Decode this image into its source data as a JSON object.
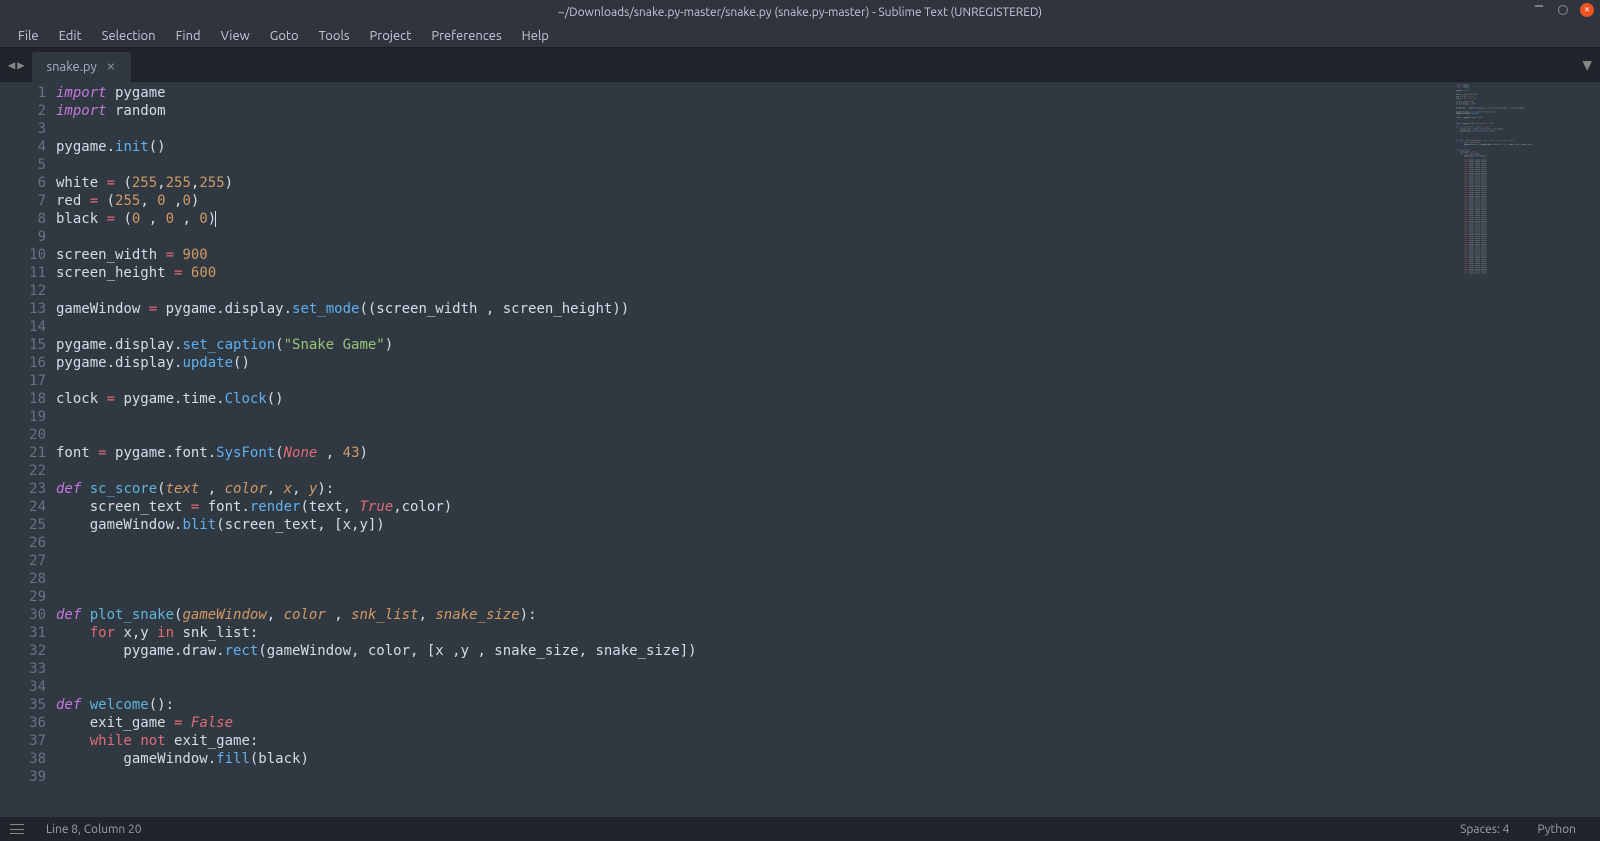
{
  "window": {
    "title": "~/Downloads/snake.py-master/snake.py (snake.py-master) - Sublime Text (UNREGISTERED)"
  },
  "menu": {
    "items": [
      "File",
      "Edit",
      "Selection",
      "Find",
      "View",
      "Goto",
      "Tools",
      "Project",
      "Preferences",
      "Help"
    ]
  },
  "tab": {
    "name": "snake.py"
  },
  "status": {
    "position": "Line 8, Column 20",
    "spaces": "Spaces: 4",
    "syntax": "Python"
  },
  "code": {
    "lines": [
      {
        "n": 1,
        "tokens": [
          {
            "t": "import",
            "c": "kw"
          },
          {
            "t": " pygame",
            "c": "plain"
          }
        ]
      },
      {
        "n": 2,
        "tokens": [
          {
            "t": "import",
            "c": "kw"
          },
          {
            "t": " random",
            "c": "plain"
          }
        ]
      },
      {
        "n": 3,
        "tokens": []
      },
      {
        "n": 4,
        "tokens": [
          {
            "t": "pygame",
            "c": "plain"
          },
          {
            "t": ".",
            "c": "plain"
          },
          {
            "t": "init",
            "c": "call"
          },
          {
            "t": "()",
            "c": "plain"
          }
        ]
      },
      {
        "n": 5,
        "tokens": []
      },
      {
        "n": 6,
        "tokens": [
          {
            "t": "white ",
            "c": "plain"
          },
          {
            "t": "=",
            "c": "op"
          },
          {
            "t": " (",
            "c": "plain"
          },
          {
            "t": "255",
            "c": "num"
          },
          {
            "t": ",",
            "c": "plain"
          },
          {
            "t": "255",
            "c": "num"
          },
          {
            "t": ",",
            "c": "plain"
          },
          {
            "t": "255",
            "c": "num"
          },
          {
            "t": ")",
            "c": "plain"
          }
        ]
      },
      {
        "n": 7,
        "tokens": [
          {
            "t": "red ",
            "c": "plain"
          },
          {
            "t": "=",
            "c": "op"
          },
          {
            "t": " (",
            "c": "plain"
          },
          {
            "t": "255",
            "c": "num"
          },
          {
            "t": ", ",
            "c": "plain"
          },
          {
            "t": "0",
            "c": "num"
          },
          {
            "t": " ,",
            "c": "plain"
          },
          {
            "t": "0",
            "c": "num"
          },
          {
            "t": ")",
            "c": "plain"
          }
        ]
      },
      {
        "n": 8,
        "tokens": [
          {
            "t": "black ",
            "c": "plain"
          },
          {
            "t": "=",
            "c": "op"
          },
          {
            "t": " (",
            "c": "plain"
          },
          {
            "t": "0",
            "c": "num"
          },
          {
            "t": " , ",
            "c": "plain"
          },
          {
            "t": "0",
            "c": "num"
          },
          {
            "t": " , ",
            "c": "plain"
          },
          {
            "t": "0",
            "c": "num"
          },
          {
            "t": ")",
            "c": "plain"
          }
        ],
        "cursor": true
      },
      {
        "n": 9,
        "tokens": []
      },
      {
        "n": 10,
        "tokens": [
          {
            "t": "screen_width ",
            "c": "plain"
          },
          {
            "t": "=",
            "c": "op"
          },
          {
            "t": " ",
            "c": "plain"
          },
          {
            "t": "900",
            "c": "num"
          }
        ]
      },
      {
        "n": 11,
        "tokens": [
          {
            "t": "screen_height ",
            "c": "plain"
          },
          {
            "t": "=",
            "c": "op"
          },
          {
            "t": " ",
            "c": "plain"
          },
          {
            "t": "600",
            "c": "num"
          }
        ]
      },
      {
        "n": 12,
        "tokens": []
      },
      {
        "n": 13,
        "tokens": [
          {
            "t": "gameWindow ",
            "c": "plain"
          },
          {
            "t": "=",
            "c": "op"
          },
          {
            "t": " pygame.display.",
            "c": "plain"
          },
          {
            "t": "set_mode",
            "c": "call"
          },
          {
            "t": "((screen_width , screen_height))",
            "c": "plain"
          }
        ]
      },
      {
        "n": 14,
        "tokens": []
      },
      {
        "n": 15,
        "tokens": [
          {
            "t": "pygame.display.",
            "c": "plain"
          },
          {
            "t": "set_caption",
            "c": "call"
          },
          {
            "t": "(",
            "c": "plain"
          },
          {
            "t": "\"Snake Game\"",
            "c": "str"
          },
          {
            "t": ")",
            "c": "plain"
          }
        ]
      },
      {
        "n": 16,
        "tokens": [
          {
            "t": "pygame.display.",
            "c": "plain"
          },
          {
            "t": "update",
            "c": "call"
          },
          {
            "t": "()",
            "c": "plain"
          }
        ]
      },
      {
        "n": 17,
        "tokens": []
      },
      {
        "n": 18,
        "tokens": [
          {
            "t": "clock ",
            "c": "plain"
          },
          {
            "t": "=",
            "c": "op"
          },
          {
            "t": " pygame.time.",
            "c": "plain"
          },
          {
            "t": "Clock",
            "c": "call"
          },
          {
            "t": "()",
            "c": "plain"
          }
        ]
      },
      {
        "n": 19,
        "tokens": []
      },
      {
        "n": 20,
        "tokens": []
      },
      {
        "n": 21,
        "tokens": [
          {
            "t": "font ",
            "c": "plain"
          },
          {
            "t": "=",
            "c": "op"
          },
          {
            "t": " pygame.font.",
            "c": "plain"
          },
          {
            "t": "SysFont",
            "c": "call"
          },
          {
            "t": "(",
            "c": "plain"
          },
          {
            "t": "None",
            "c": "bool"
          },
          {
            "t": " , ",
            "c": "plain"
          },
          {
            "t": "43",
            "c": "num"
          },
          {
            "t": ")",
            "c": "plain"
          }
        ]
      },
      {
        "n": 22,
        "tokens": []
      },
      {
        "n": 23,
        "tokens": [
          {
            "t": "def",
            "c": "def"
          },
          {
            "t": " ",
            "c": "plain"
          },
          {
            "t": "sc_score",
            "c": "fn"
          },
          {
            "t": "(",
            "c": "plain"
          },
          {
            "t": "text",
            "c": "param"
          },
          {
            "t": " , ",
            "c": "plain"
          },
          {
            "t": "color",
            "c": "param"
          },
          {
            "t": ", ",
            "c": "plain"
          },
          {
            "t": "x",
            "c": "param"
          },
          {
            "t": ", ",
            "c": "plain"
          },
          {
            "t": "y",
            "c": "param"
          },
          {
            "t": "):",
            "c": "plain"
          }
        ]
      },
      {
        "n": 24,
        "tokens": [
          {
            "t": "    screen_text ",
            "c": "plain"
          },
          {
            "t": "=",
            "c": "op"
          },
          {
            "t": " font.",
            "c": "plain"
          },
          {
            "t": "render",
            "c": "call"
          },
          {
            "t": "(text, ",
            "c": "plain"
          },
          {
            "t": "True",
            "c": "bool"
          },
          {
            "t": ",color)",
            "c": "plain"
          }
        ]
      },
      {
        "n": 25,
        "tokens": [
          {
            "t": "    gameWindow.",
            "c": "plain"
          },
          {
            "t": "blit",
            "c": "call"
          },
          {
            "t": "(screen_text, [x,y])",
            "c": "plain"
          }
        ]
      },
      {
        "n": 26,
        "tokens": []
      },
      {
        "n": 27,
        "tokens": []
      },
      {
        "n": 28,
        "tokens": []
      },
      {
        "n": 29,
        "tokens": []
      },
      {
        "n": 30,
        "tokens": [
          {
            "t": "def",
            "c": "def"
          },
          {
            "t": " ",
            "c": "plain"
          },
          {
            "t": "plot_snake",
            "c": "fn"
          },
          {
            "t": "(",
            "c": "plain"
          },
          {
            "t": "gameWindow",
            "c": "param"
          },
          {
            "t": ", ",
            "c": "plain"
          },
          {
            "t": "color",
            "c": "param"
          },
          {
            "t": " , ",
            "c": "plain"
          },
          {
            "t": "snk_list",
            "c": "param"
          },
          {
            "t": ", ",
            "c": "plain"
          },
          {
            "t": "snake_size",
            "c": "param"
          },
          {
            "t": "):",
            "c": "plain"
          }
        ]
      },
      {
        "n": 31,
        "tokens": [
          {
            "t": "    ",
            "c": "plain"
          },
          {
            "t": "for",
            "c": "kw2"
          },
          {
            "t": " x,y ",
            "c": "plain"
          },
          {
            "t": "in",
            "c": "kw2"
          },
          {
            "t": " snk_list:",
            "c": "plain"
          }
        ]
      },
      {
        "n": 32,
        "tokens": [
          {
            "t": "        pygame.draw.",
            "c": "plain"
          },
          {
            "t": "rect",
            "c": "call"
          },
          {
            "t": "(gameWindow, color, [x ,y , snake_size, snake_size])",
            "c": "plain"
          }
        ]
      },
      {
        "n": 33,
        "tokens": []
      },
      {
        "n": 34,
        "tokens": []
      },
      {
        "n": 35,
        "tokens": [
          {
            "t": "def",
            "c": "def"
          },
          {
            "t": " ",
            "c": "plain"
          },
          {
            "t": "welcome",
            "c": "fn"
          },
          {
            "t": "():",
            "c": "plain"
          }
        ]
      },
      {
        "n": 36,
        "tokens": [
          {
            "t": "    exit_game ",
            "c": "plain"
          },
          {
            "t": "=",
            "c": "op"
          },
          {
            "t": " ",
            "c": "plain"
          },
          {
            "t": "False",
            "c": "bool"
          }
        ]
      },
      {
        "n": 37,
        "tokens": [
          {
            "t": "    ",
            "c": "plain"
          },
          {
            "t": "while",
            "c": "kw2"
          },
          {
            "t": " ",
            "c": "plain"
          },
          {
            "t": "not",
            "c": "kw2"
          },
          {
            "t": " exit_game:",
            "c": "plain"
          }
        ]
      },
      {
        "n": 38,
        "tokens": [
          {
            "t": "        gameWindow.",
            "c": "plain"
          },
          {
            "t": "fill",
            "c": "call"
          },
          {
            "t": "(black)",
            "c": "plain"
          }
        ]
      },
      {
        "n": 39,
        "tokens": []
      }
    ]
  }
}
